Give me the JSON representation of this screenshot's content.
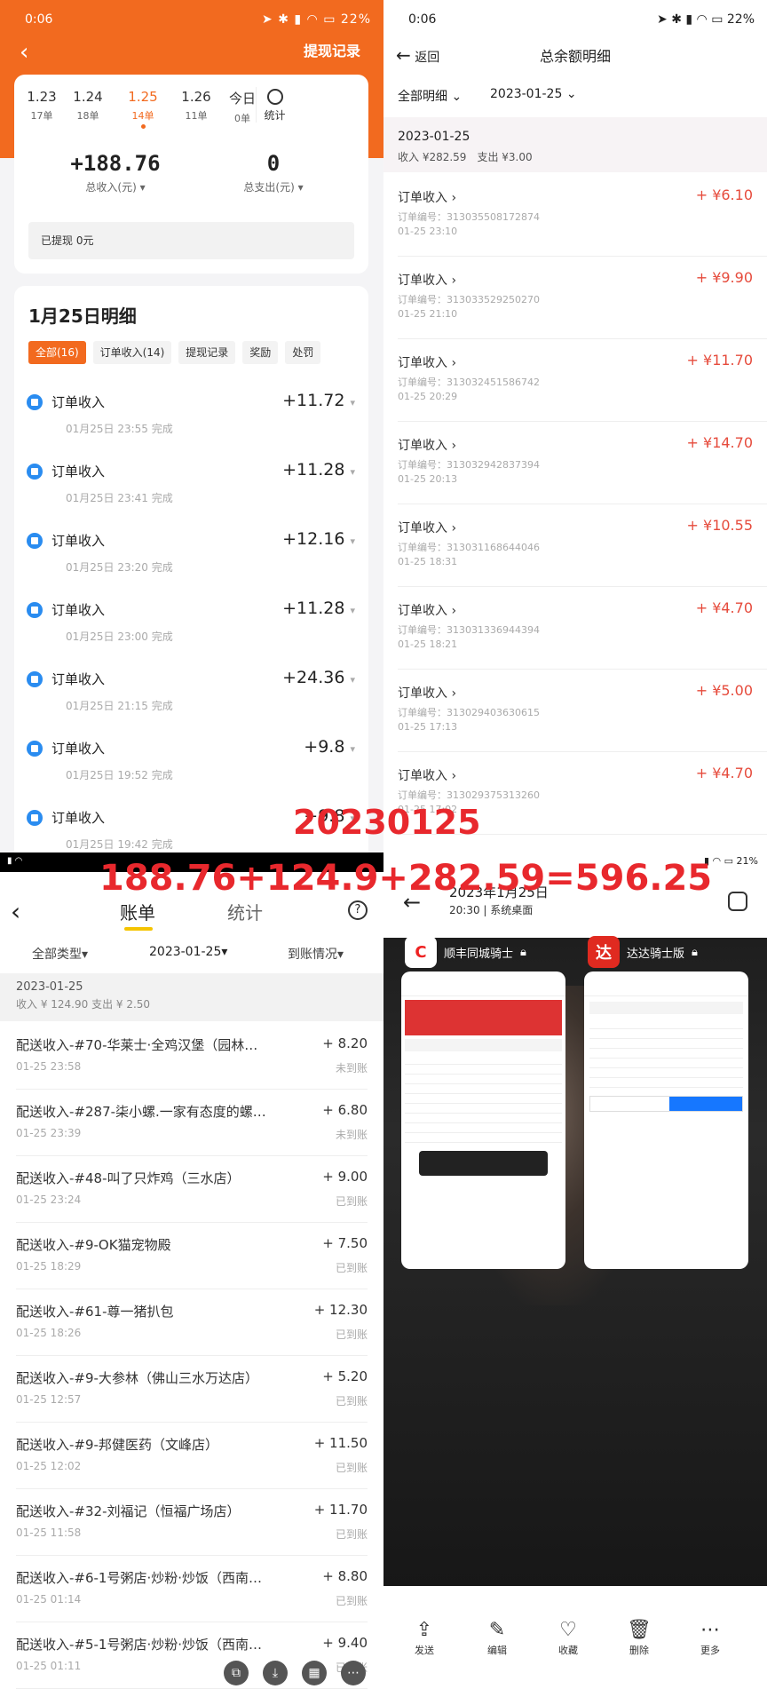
{
  "p1": {
    "status": {
      "time": "0:06",
      "battery": "22%"
    },
    "header_title": "提现记录",
    "dates": [
      {
        "d": "1.23",
        "c": "17单"
      },
      {
        "d": "1.24",
        "c": "18单"
      },
      {
        "d": "1.25",
        "c": "14单"
      },
      {
        "d": "1.26",
        "c": "11单"
      },
      {
        "d": "今日",
        "c": "0单"
      }
    ],
    "stats_label": "统计",
    "income_value": "+188.76",
    "income_label": "总收入(元)",
    "expense_value": "0",
    "expense_label": "总支出(元)",
    "withdrawn": "已提现 0元",
    "day_title": "1月25日明细",
    "chips": [
      "全部(16)",
      "订单收入(14)",
      "提现记录",
      "奖励",
      "处罚"
    ],
    "rows": [
      {
        "n": "订单收入",
        "m": "+11.72",
        "s": "01月25日 23:55 完成"
      },
      {
        "n": "订单收入",
        "m": "+11.28",
        "s": "01月25日 23:41 完成"
      },
      {
        "n": "订单收入",
        "m": "+12.16",
        "s": "01月25日 23:20 完成"
      },
      {
        "n": "订单收入",
        "m": "+11.28",
        "s": "01月25日 23:00 完成"
      },
      {
        "n": "订单收入",
        "m": "+24.36",
        "s": "01月25日 21:15 完成"
      },
      {
        "n": "订单收入",
        "m": "+9.8",
        "s": "01月25日 19:52 完成"
      },
      {
        "n": "订单收入",
        "m": "+9.8",
        "s": "01月25日 19:42 完成"
      }
    ]
  },
  "p2": {
    "status": {
      "time": "0:06",
      "battery": "22%"
    },
    "back": "返回",
    "title": "总余额明细",
    "filter_all": "全部明细",
    "filter_date": "2023-01-25",
    "day": "2023-01-25",
    "summary": "收入 ¥282.59　支出 ¥3.00",
    "rows": [
      {
        "n": "订单收入",
        "no": "订单编号：313035508172874",
        "t": "01-25 23:10",
        "m": "+ ¥6.10"
      },
      {
        "n": "订单收入",
        "no": "订单编号：313033529250270",
        "t": "01-25 21:10",
        "m": "+ ¥9.90"
      },
      {
        "n": "订单收入",
        "no": "订单编号：313032451586742",
        "t": "01-25 20:29",
        "m": "+ ¥11.70"
      },
      {
        "n": "订单收入",
        "no": "订单编号：313032942837394",
        "t": "01-25 20:13",
        "m": "+ ¥14.70"
      },
      {
        "n": "订单收入",
        "no": "订单编号：313031168644046",
        "t": "01-25 18:31",
        "m": "+ ¥10.55"
      },
      {
        "n": "订单收入",
        "no": "订单编号：313031336944394",
        "t": "01-25 18:21",
        "m": "+ ¥4.70"
      },
      {
        "n": "订单收入",
        "no": "订单编号：313029403630615",
        "t": "01-25 17:13",
        "m": "+ ¥5.00"
      },
      {
        "n": "订单收入",
        "no": "订单编号：313029375313260",
        "t": "01-25 17:02",
        "m": "+ ¥4.70"
      }
    ]
  },
  "p3": {
    "tab_bill": "账单",
    "tab_stats": "统计",
    "help": "?",
    "filter_type": "全部类型",
    "filter_date": "2023-01-25",
    "filter_status": "到账情况",
    "day": "2023-01-25",
    "summary": "收入 ¥ 124.90 支出 ¥ 2.50",
    "rows": [
      {
        "n": "配送收入-#70-华莱士·全鸡汉堡（园林…",
        "t": "01-25 23:58",
        "m": "+ 8.20",
        "s": "未到账"
      },
      {
        "n": "配送收入-#287-柒小螺.一家有态度的螺…",
        "t": "01-25 23:39",
        "m": "+ 6.80",
        "s": "未到账"
      },
      {
        "n": "配送收入-#48-叫了只炸鸡（三水店）",
        "t": "01-25 23:24",
        "m": "+ 9.00",
        "s": "已到账"
      },
      {
        "n": "配送收入-#9-OK猫宠物殿",
        "t": "01-25 18:29",
        "m": "+ 7.50",
        "s": "已到账"
      },
      {
        "n": "配送收入-#61-尊一猪扒包",
        "t": "01-25 18:26",
        "m": "+ 12.30",
        "s": "已到账"
      },
      {
        "n": "配送收入-#9-大参林（佛山三水万达店）",
        "t": "01-25 12:57",
        "m": "+ 5.20",
        "s": "已到账"
      },
      {
        "n": "配送收入-#9-邦健医药（文峰店）",
        "t": "01-25 12:02",
        "m": "+ 11.50",
        "s": "已到账"
      },
      {
        "n": "配送收入-#32-刘福记（恒福广场店）",
        "t": "01-25 11:58",
        "m": "+ 11.70",
        "s": "已到账"
      },
      {
        "n": "配送收入-#6-1号粥店·炒粉·炒饭（西南…",
        "t": "01-25 01:14",
        "m": "+ 8.80",
        "s": "已到账"
      },
      {
        "n": "配送收入-#5-1号粥店·炒粉·炒饭（西南…",
        "t": "01-25 01:11",
        "m": "+ 9.40",
        "s": "已到账"
      }
    ]
  },
  "p4": {
    "battery": "21%",
    "title": "2023年1月25日",
    "subtitle": "20:30 | 系统桌面",
    "app1": "顺丰同城骑士",
    "app2": "达达骑士版",
    "bottom": [
      "发送",
      "编辑",
      "收藏",
      "删除",
      "更多"
    ]
  },
  "overlay": {
    "date": "20230125",
    "formula": "188.76+124.9+282.59=596.25"
  }
}
